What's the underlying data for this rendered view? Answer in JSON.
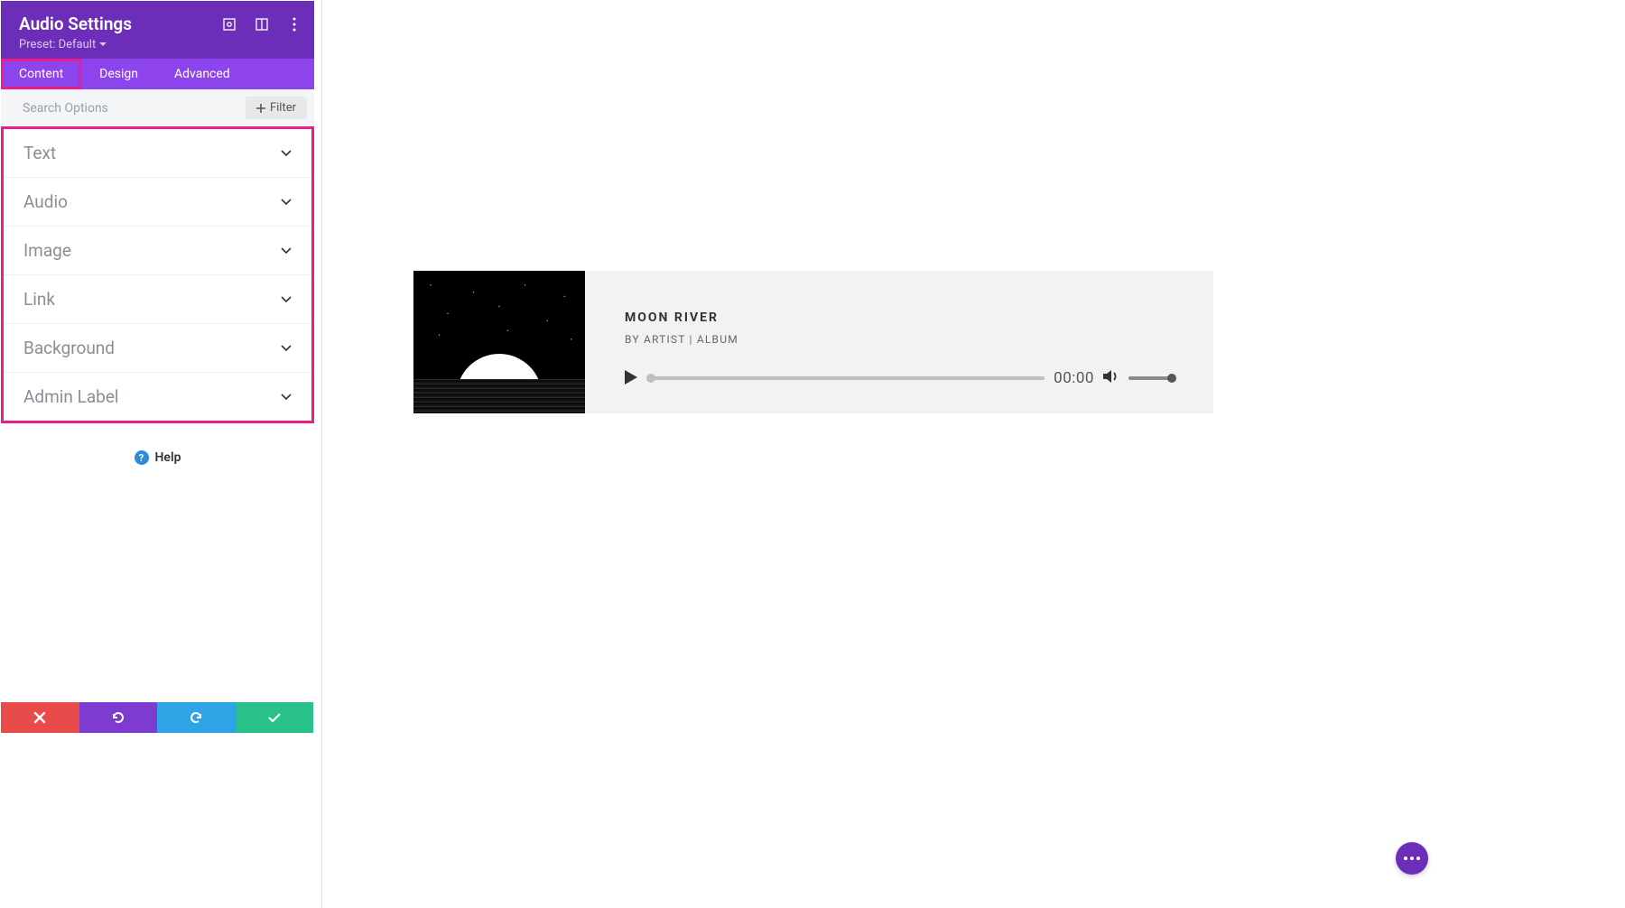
{
  "panel": {
    "title": "Audio Settings",
    "preset_label": "Preset: Default"
  },
  "tabs": {
    "content": "Content",
    "design": "Design",
    "advanced": "Advanced"
  },
  "search": {
    "placeholder": "Search Options",
    "filter_label": "Filter"
  },
  "accordion": {
    "items": [
      "Text",
      "Audio",
      "Image",
      "Link",
      "Background",
      "Admin Label"
    ]
  },
  "help": {
    "label": "Help"
  },
  "player": {
    "title": "MOON RIVER",
    "meta": "BY ARTIST | ALBUM",
    "time": "00:00"
  }
}
